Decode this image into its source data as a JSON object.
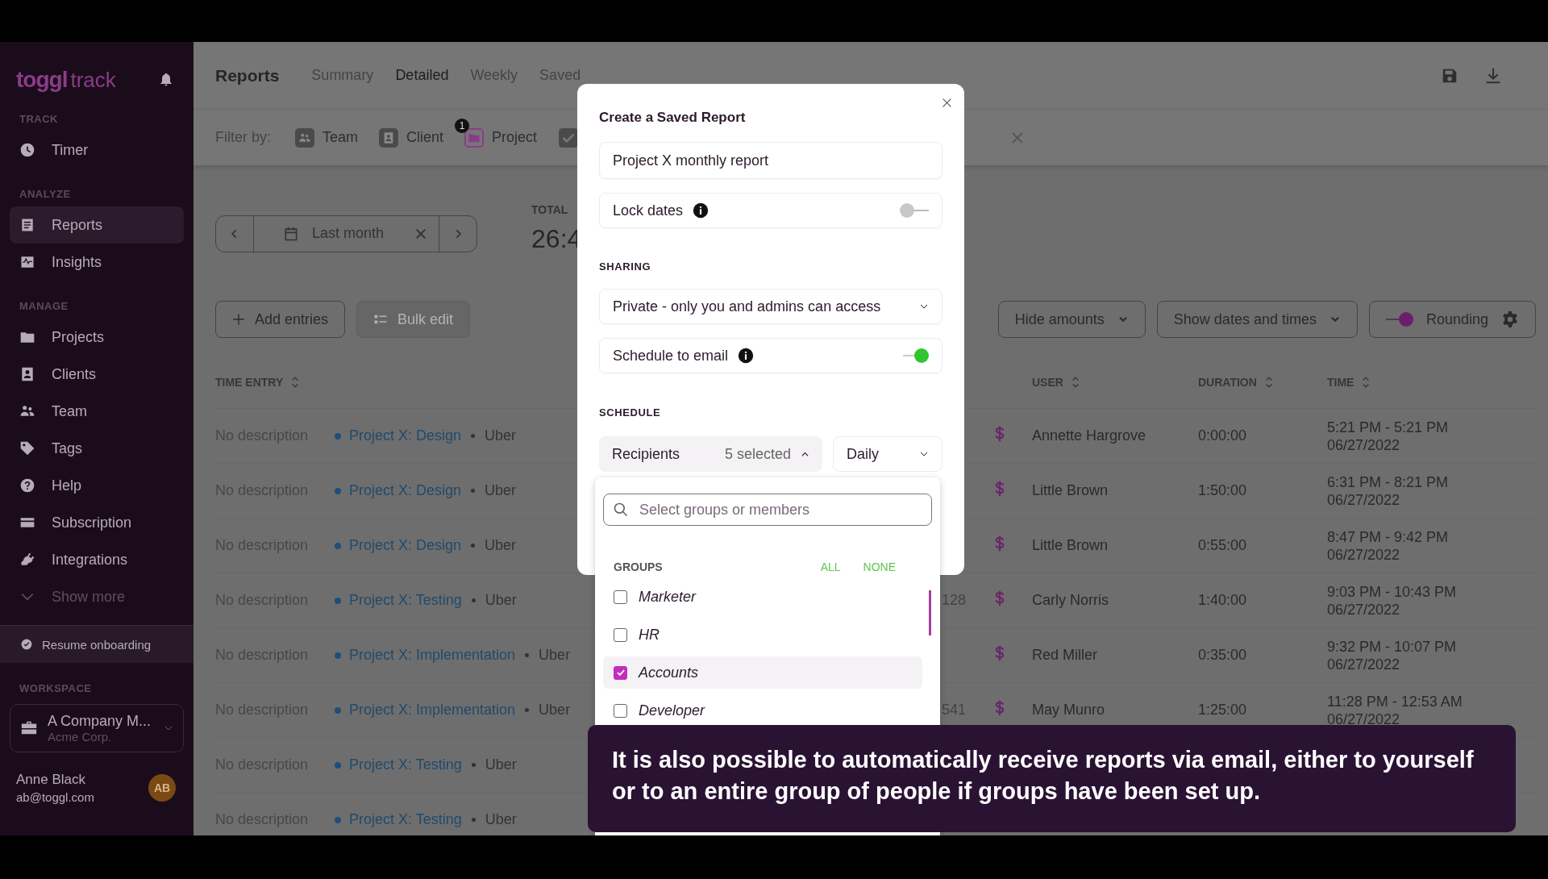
{
  "sidebar": {
    "logo_brand": "toggl",
    "logo_product": "track",
    "sections": [
      {
        "title": "TRACK",
        "items": [
          {
            "label": "Timer",
            "selected": false
          }
        ]
      },
      {
        "title": "ANALYZE",
        "items": [
          {
            "label": "Reports",
            "selected": true
          },
          {
            "label": "Insights",
            "selected": false
          }
        ]
      },
      {
        "title": "MANAGE",
        "items": [
          {
            "label": "Projects",
            "selected": false
          },
          {
            "label": "Clients",
            "selected": false
          },
          {
            "label": "Team",
            "selected": false
          },
          {
            "label": "Tags",
            "selected": false
          },
          {
            "label": "Help",
            "selected": false
          },
          {
            "label": "Subscription",
            "selected": false
          },
          {
            "label": "Integrations",
            "selected": false
          }
        ]
      }
    ],
    "show_more": "Show more",
    "onboarding": "Resume onboarding",
    "workspace": {
      "title": "WORKSPACE",
      "name": "A Company M...",
      "org": "Acme Corp."
    },
    "user": {
      "name": "Anne Black",
      "email": "ab@toggl.com",
      "initials": "AB"
    }
  },
  "header": {
    "title": "Reports",
    "tabs": [
      {
        "label": "Summary",
        "selected": false
      },
      {
        "label": "Detailed",
        "selected": true
      },
      {
        "label": "Weekly",
        "selected": false
      },
      {
        "label": "Saved",
        "selected": false
      }
    ]
  },
  "filter": {
    "label": "Filter by:",
    "items": [
      {
        "label": "Team"
      },
      {
        "label": "Client"
      },
      {
        "label": "Project",
        "badge": "1"
      }
    ]
  },
  "toolbar": {
    "date_range": "Last month",
    "total_label": "TOTAL",
    "total_value": "26:4",
    "add_button": "Add entries",
    "bulk_button": {
      "label": "Bulk edit",
      "disabled": true
    },
    "options": [
      {
        "kind": "dropdown",
        "label": "Hide amounts"
      },
      {
        "kind": "dropdown",
        "label": "Show dates and times"
      },
      {
        "kind": "toggle",
        "label": "Rounding",
        "on": true
      }
    ]
  },
  "table": {
    "columns": [
      "TIME ENTRY",
      "USER",
      "DURATION",
      "TIME"
    ],
    "rows": [
      {
        "description": "No description",
        "project": "Project X: Design",
        "client": "Uber",
        "user": "Annette Hargrove",
        "duration": "0:00:00",
        "time": "5:21 PM - 5:21 PM",
        "date": "06/27/2022"
      },
      {
        "description": "No description",
        "project": "Project X: Design",
        "client": "Uber",
        "user": "Little Brown",
        "duration": "1:50:00",
        "time": "6:31 PM - 8:21 PM",
        "date": "06/27/2022"
      },
      {
        "description": "No description",
        "project": "Project X: Design",
        "client": "Uber",
        "user": "Little Brown",
        "duration": "0:55:00",
        "time": "8:47 PM - 9:42 PM",
        "date": "06/27/2022"
      },
      {
        "description": "No description",
        "project": "Project X: Testing",
        "client": "Uber",
        "column_3": "128",
        "user": "Carly Norris",
        "duration": "1:40:00",
        "time": "9:03 PM - 10:43 PM",
        "date": "06/27/2022"
      },
      {
        "description": "No description",
        "project": "Project X: Implementation",
        "client": "Uber",
        "user": "Red Miller",
        "duration": "0:35:00",
        "time": "9:32 PM - 10:07 PM",
        "date": "06/27/2022"
      },
      {
        "description": "No description",
        "project": "Project X: Implementation",
        "client": "Uber",
        "column_3": "541",
        "user": "May Munro",
        "duration": "1:25:00",
        "time": "11:28 PM - 12:53 AM",
        "date": "06/27/2022"
      },
      {
        "description": "No description",
        "project": "Project X: Testing",
        "client": "Uber"
      },
      {
        "description": "No description",
        "project": "Project X: Testing",
        "client": "Uber"
      }
    ]
  },
  "modal": {
    "title": "Create a Saved Report",
    "name_value": "Project X monthly report",
    "lock_dates": {
      "label": "Lock dates",
      "on": false
    },
    "sharing_label": "SHARING",
    "sharing_value": "Private - only you and admins can access",
    "schedule_email": {
      "label": "Schedule to email",
      "on": true
    },
    "schedule_label": "SCHEDULE",
    "recipients": {
      "label": "Recipients",
      "count": "5 selected",
      "expanded": true
    },
    "frequency": "Daily"
  },
  "dropdown": {
    "search_placeholder": "Select groups or members",
    "groups_label": "GROUPS",
    "all": "ALL",
    "none": "NONE",
    "groups": [
      {
        "label": "Marketer",
        "checked": false,
        "hovered": false
      },
      {
        "label": "HR",
        "checked": false,
        "hovered": false
      },
      {
        "label": "Accounts",
        "checked": true,
        "hovered": true
      },
      {
        "label": "Developer",
        "checked": false,
        "hovered": false
      }
    ]
  },
  "caption": {
    "text": "It is also possible to automatically receive reports via email, either to yourself or to an entire group of people if groups have been set up."
  }
}
